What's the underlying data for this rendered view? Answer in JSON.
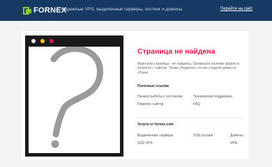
{
  "header": {
    "logo_text": "FORNEX",
    "tagline": "Надежные VPS, выделенные серверы, хостинг и домены",
    "goto_site": "Перейти на сайт"
  },
  "main": {
    "title": "Страница не найдена",
    "description": "Файл или страница - не найдены. Проверьте наличие файла в каталоге с сайтом. Также убедитесь что вы создали домен в cPanel.",
    "useful_links": {
      "heading": "Полезные ссылки",
      "items": [
        "Начало работы с хостингом",
        "Техническая поддержка",
        "Перенос сайтов",
        "FAQ"
      ]
    },
    "services": {
      "heading": "Услуги от fornex.com",
      "items": [
        "Выделенные серверы",
        "SSD хостинг",
        "Домены",
        "SSD VPS",
        "VPN"
      ]
    }
  },
  "colors": {
    "header_bg": "#163a63",
    "accent_red": "#e8154e",
    "logo_green": "#8cc63f",
    "dot_yellow": "#f6c900"
  },
  "icons": [
    "fornex-logo-icon",
    "question-mark-icon"
  ]
}
